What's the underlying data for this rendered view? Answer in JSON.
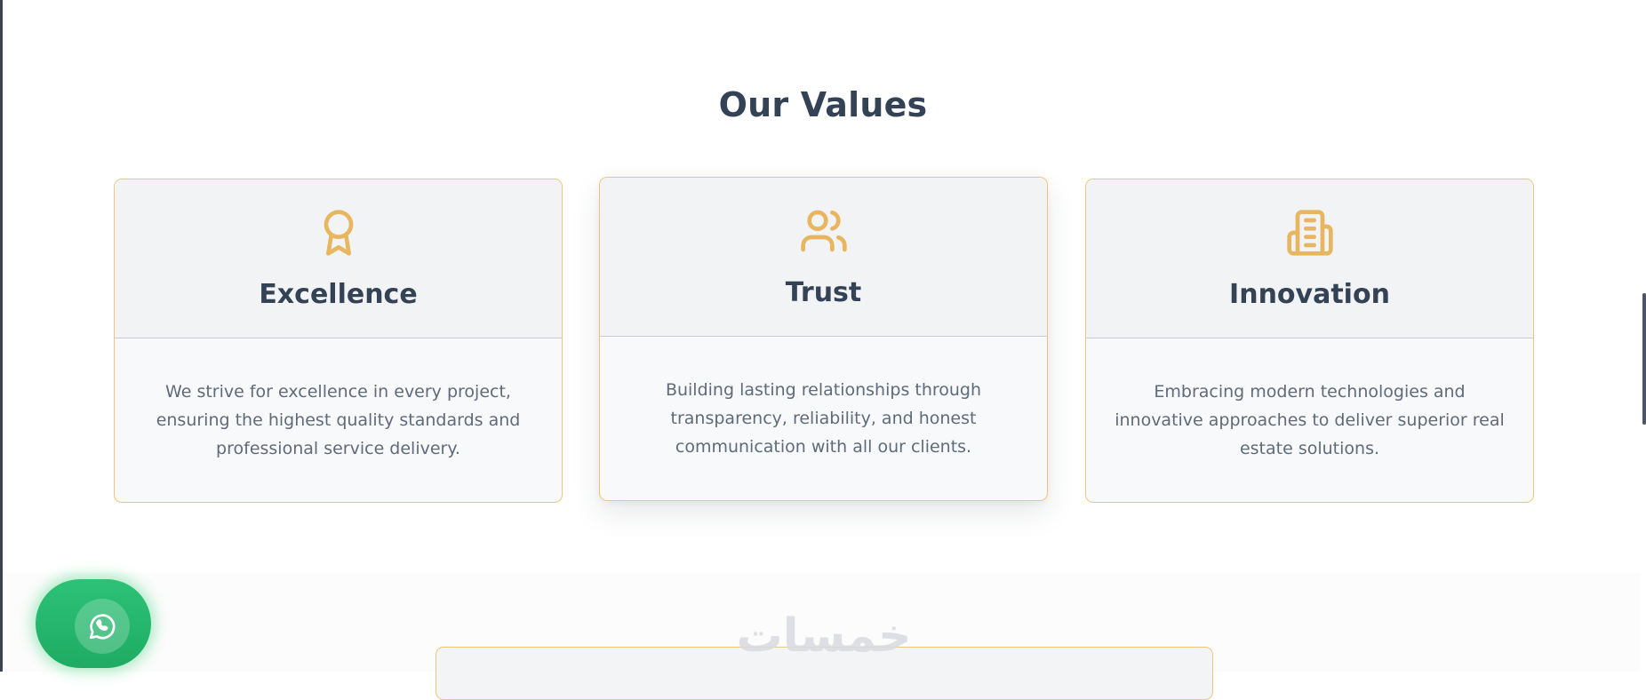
{
  "section": {
    "title": "Our Values"
  },
  "cards": [
    {
      "title": "Excellence",
      "icon": "award-icon",
      "text": "We strive for excellence in every project, ensuring the highest quality standards and professional service delivery."
    },
    {
      "title": "Trust",
      "icon": "users-icon",
      "text": "Building lasting relationships through transparency, reliability, and honest communication with all our clients."
    },
    {
      "title": "Innovation",
      "icon": "building-icon",
      "text": "Embracing modern technologies and innovative approaches to deliver superior real estate solutions."
    }
  ],
  "watermark": {
    "text": "خمسات"
  },
  "floating": {
    "whatsapp_icon": "whatsapp-icon"
  },
  "colors": {
    "accent": "#ecc77b",
    "icon": "#e8b560",
    "heading": "#344256",
    "body_text": "#5f6b7a",
    "whatsapp": "#25b86c"
  }
}
